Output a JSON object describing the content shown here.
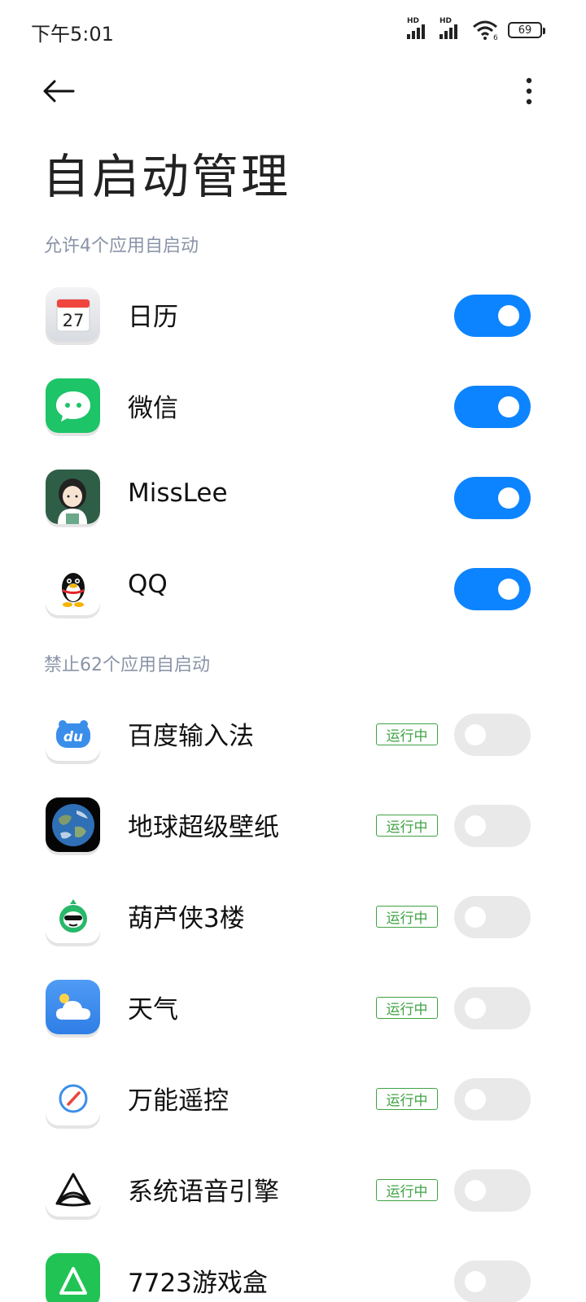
{
  "status": {
    "time": "下午5:01",
    "sim1": "HD",
    "sim2": "HD",
    "wifi_sub": "6",
    "battery": "69"
  },
  "page": {
    "title": "自启动管理"
  },
  "sections": {
    "allowed": "允许4个应用自启动",
    "blocked": "禁止62个应用自启动"
  },
  "allowed_apps": [
    {
      "name": "日历",
      "icon": "calendar-icon",
      "calendar_day": "27",
      "enabled": true
    },
    {
      "name": "微信",
      "icon": "wechat-icon",
      "enabled": true
    },
    {
      "name": "MissLee",
      "icon": "misslee-avatar-icon",
      "enabled": true
    },
    {
      "name": "QQ",
      "icon": "qq-penguin-icon",
      "enabled": true
    }
  ],
  "blocked_apps": [
    {
      "name": "百度输入法",
      "icon": "baidu-input-icon",
      "icon_text": "du",
      "badge": "运行中",
      "enabled": false
    },
    {
      "name": "地球超级壁纸",
      "icon": "earth-icon",
      "badge": "运行中",
      "enabled": false
    },
    {
      "name": "葫芦侠3楼",
      "icon": "huluxia-icon",
      "badge": "运行中",
      "enabled": false
    },
    {
      "name": "天气",
      "icon": "weather-icon",
      "badge": "运行中",
      "enabled": false
    },
    {
      "name": "万能遥控",
      "icon": "remote-control-icon",
      "badge": "运行中",
      "enabled": false
    },
    {
      "name": "系统语音引擎",
      "icon": "voice-engine-icon",
      "badge": "运行中",
      "enabled": false
    },
    {
      "name": "7723游戏盒",
      "icon": "game-box-icon",
      "enabled": false
    }
  ],
  "colors": {
    "accent": "#0d84ff",
    "running": "#3fa344",
    "section_label": "#8a94a8",
    "toggle_off": "#e9e9e9"
  }
}
